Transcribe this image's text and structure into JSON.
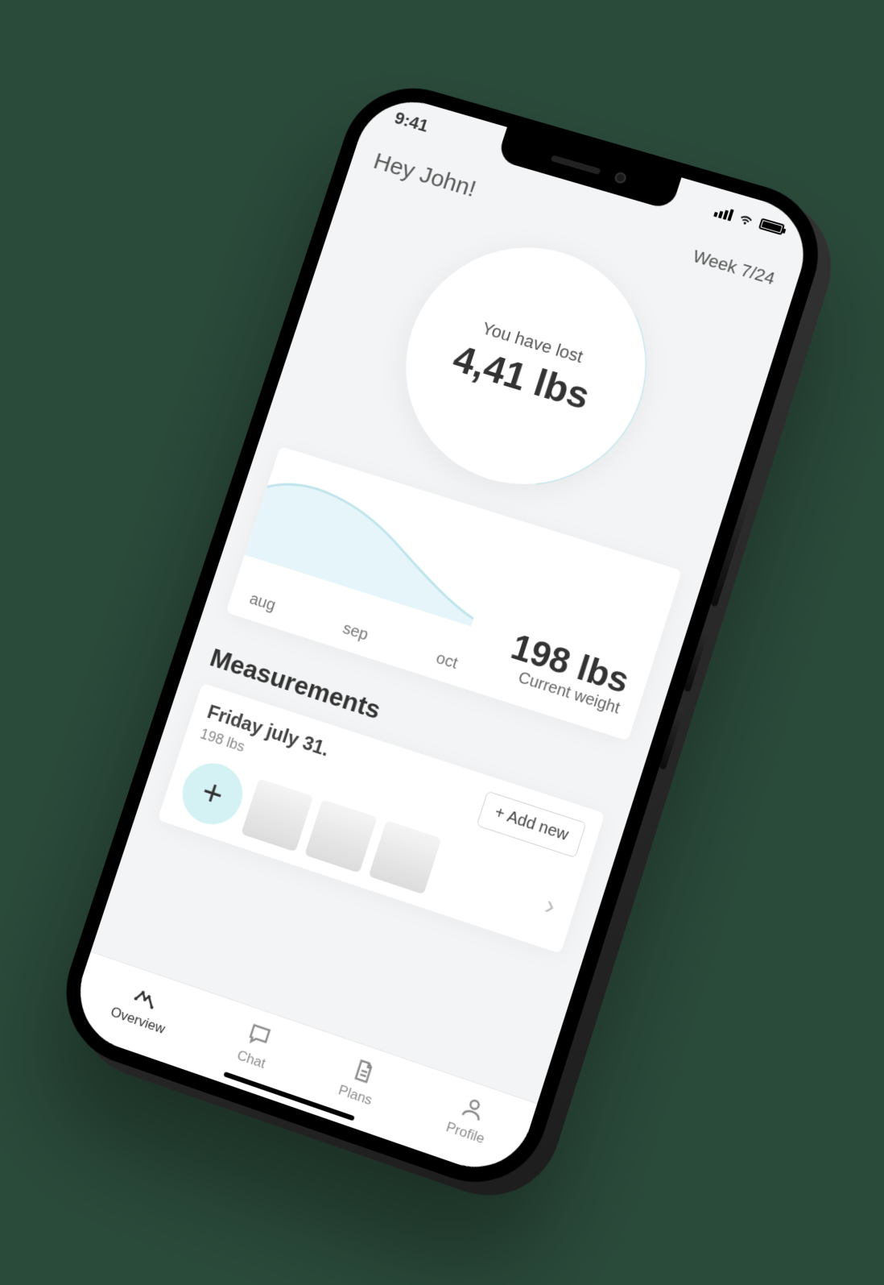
{
  "status": {
    "time": "9:41"
  },
  "header": {
    "greeting": "Hey John!",
    "week_label": "Week 7/24"
  },
  "progress_ring": {
    "caption": "You have lost",
    "value": "4,41 lbs",
    "percent": 0.29,
    "accent": "#cbeef4"
  },
  "chart_data": {
    "type": "area",
    "x_labels": [
      "aug",
      "sep",
      "oct"
    ],
    "series": [
      {
        "name": "weight",
        "values": [
          202,
          200,
          198
        ]
      }
    ],
    "ylim": [
      196,
      204
    ],
    "current_value": "198 lbs",
    "current_label": "Current weight",
    "fill": "#e5f5f9"
  },
  "measurements": {
    "title": "Measurements",
    "entry_date": "Friday july 31.",
    "entry_sub": "198 lbs",
    "add_new_label": "+ Add new",
    "thumbs_count": 3
  },
  "tabs": [
    {
      "id": "overview",
      "label": "Overview",
      "active": true
    },
    {
      "id": "chat",
      "label": "Chat",
      "active": false
    },
    {
      "id": "plans",
      "label": "Plans",
      "active": false
    },
    {
      "id": "profile",
      "label": "Profile",
      "active": false
    }
  ]
}
